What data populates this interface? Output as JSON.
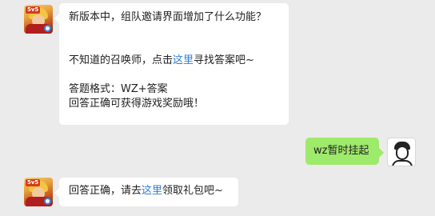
{
  "messages": [
    {
      "question": "新版本中，组队邀请界面增加了什么功能？",
      "hint_prefix": "不知道的召唤师，点击",
      "hint_link": "这里",
      "hint_suffix": "寻找答案吧~",
      "format": "答题格式：WZ+答案",
      "reward": "回答正确可获得游戏奖励哦！"
    },
    {
      "reply": "wz暂时挂起"
    },
    {
      "prefix": "回答正确，请去",
      "link": "这里",
      "suffix": "领取礼包吧~"
    }
  ],
  "avatars": {
    "bot_badge": "5v5"
  }
}
